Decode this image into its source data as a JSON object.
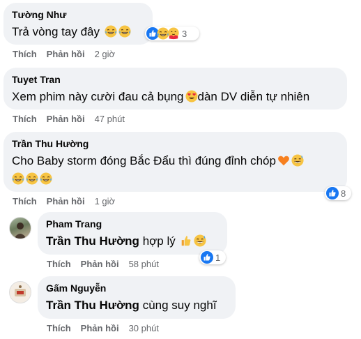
{
  "actions": {
    "like": "Thích",
    "reply": "Phản hồi"
  },
  "comments": [
    {
      "author": "Tường Như",
      "text": "Trả vòng tay đây",
      "time": "2 giờ",
      "reaction_count": "3"
    },
    {
      "author": "Tuyet Tran",
      "text_before": "Xem phim này cười đau cả bụng",
      "text_after": "dàn DV diễn tự nhiên",
      "time": "47 phút"
    },
    {
      "author": "Trần Thu Hường",
      "text": "Cho Baby storm đóng Bắc Đẩu thì đúng đỉnh chóp",
      "time": "1 giờ",
      "reaction_count": "8"
    }
  ],
  "replies": [
    {
      "author": "Pham Trang",
      "mention": "Trần Thu Hường",
      "text": "hợp lý",
      "time": "58 phút",
      "reaction_count": "1"
    },
    {
      "author": "Gấm Nguyễn",
      "mention": "Trần Thu Hường",
      "text": "cùng suy nghĩ",
      "time": "30 phút"
    }
  ],
  "icons": [
    "laugh-cry-icon",
    "like-reaction-icon",
    "heart-eyes-icon",
    "orange-heart-icon",
    "grin-sweat-icon",
    "thumbs-up-icon",
    "hug-reaction-icon",
    "avatar-photo"
  ],
  "colors": {
    "bubble": "#f0f2f5",
    "meta": "#65676b",
    "like_blue": "#1877f2"
  }
}
